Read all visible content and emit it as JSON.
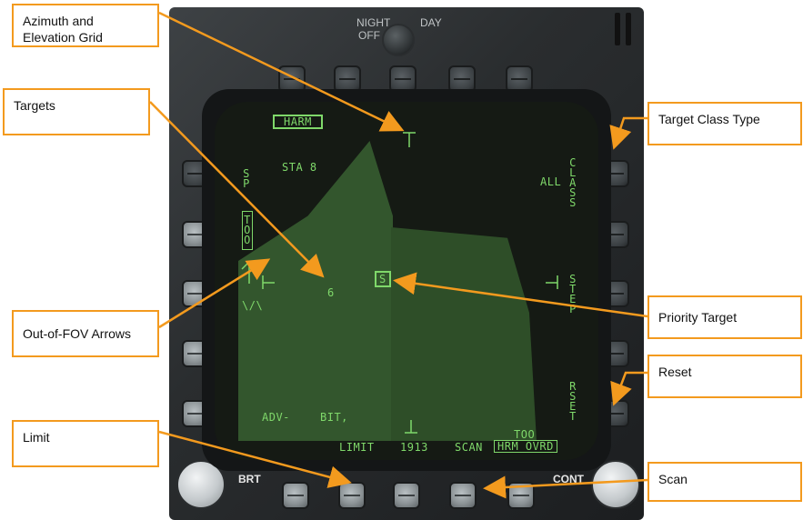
{
  "bezel": {
    "night_label": "NIGHT",
    "off_label": "OFF",
    "day_label": "DAY",
    "brt_label": "BRT",
    "cont_label": "CONT"
  },
  "mfd": {
    "harm_box": "HARM",
    "station": "STA 8",
    "sp_label": "SP",
    "too_label": "TOO",
    "class_value": "ALL",
    "class_label": "CLASS",
    "step_label": "STEP",
    "reset_label": "RSET",
    "target_number": "6",
    "priority_target": "S",
    "adv_label": "ADV-",
    "bit_label": "BIT,",
    "limit_label": "LIMIT",
    "freq_value": "1913",
    "scan_label": "SCAN",
    "too_small": "TOO",
    "harm_ovrd": "HRM OVRD",
    "arrow_glyph": "\\/\\"
  },
  "callouts": {
    "azimuth": "Azimuth and Elevation Grid",
    "targets": "Targets",
    "out_of_fov": "Out-of-FOV Arrows",
    "limit": "Limit",
    "target_class": "Target Class Type",
    "priority_target": "Priority Target",
    "reset": "Reset",
    "scan": "Scan"
  },
  "colors": {
    "callout_border": "#f39a1e",
    "symbology": "#7fd86a"
  }
}
